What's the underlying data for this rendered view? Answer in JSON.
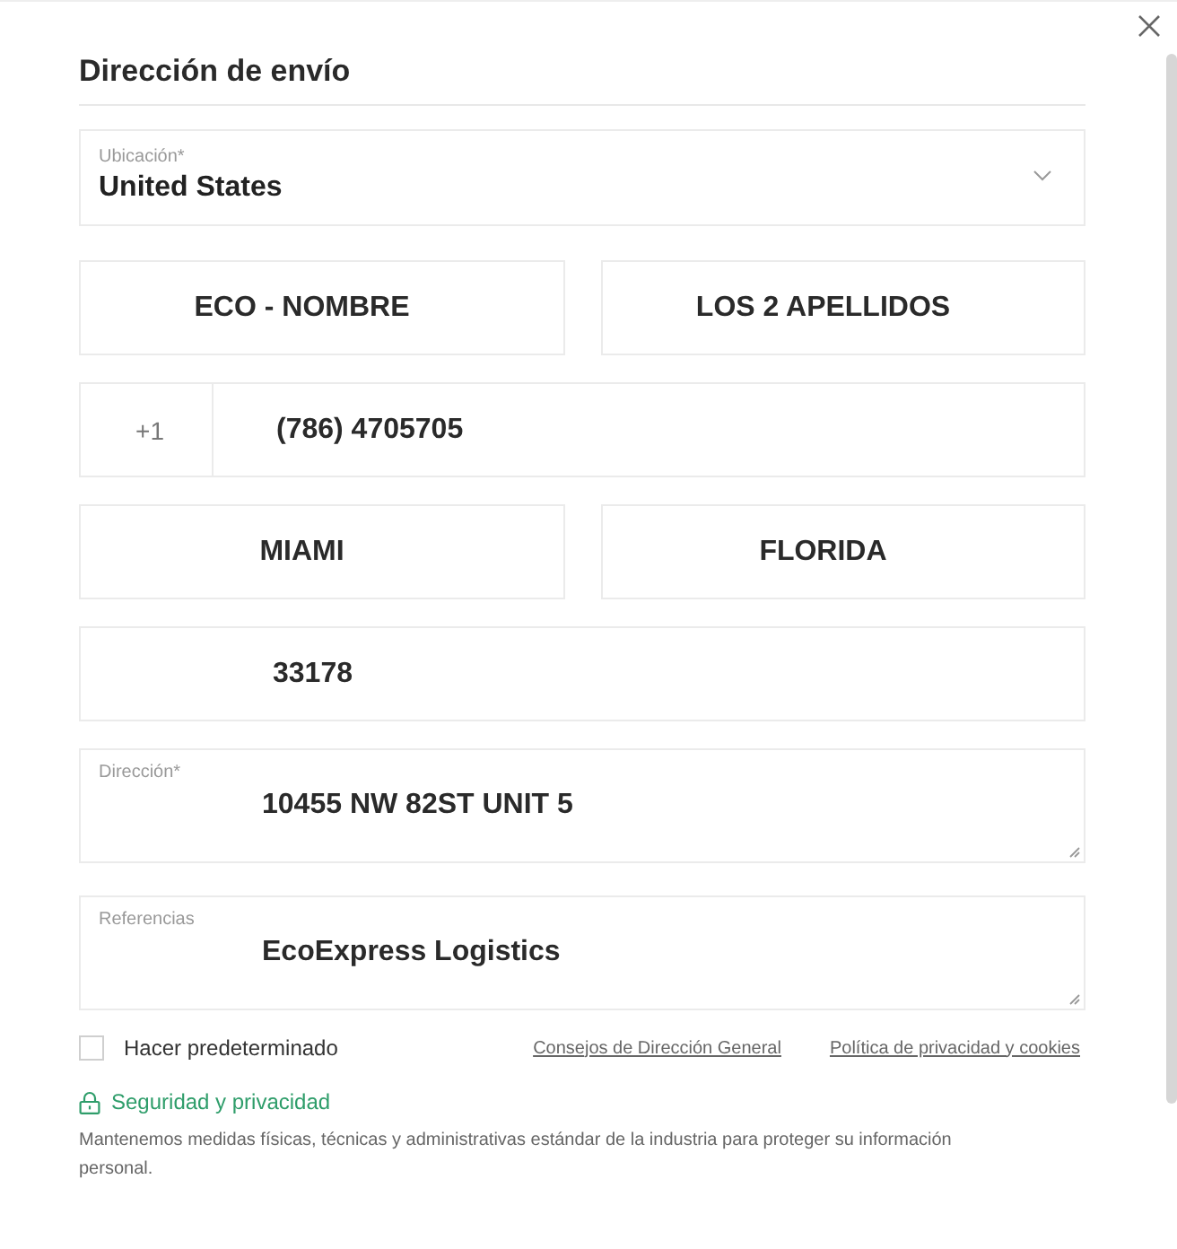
{
  "dialog": {
    "title": "Dirección de envío"
  },
  "location": {
    "label": "Ubicación*",
    "value": "United States"
  },
  "field_rows": [
    [
      {
        "kind": "text",
        "value": "ECO - NOMBRE"
      },
      {
        "kind": "text",
        "value": "LOS 2 APELLIDOS"
      }
    ],
    [
      {
        "kind": "phone",
        "prefix": "+1",
        "value": "(786) 4705705"
      }
    ],
    [
      {
        "kind": "text",
        "value": "MIAMI"
      },
      {
        "kind": "text",
        "value": "FLORIDA"
      }
    ],
    [
      {
        "kind": "text",
        "value": "33178"
      }
    ]
  ],
  "text_areas": [
    {
      "label": "Dirección*",
      "value": "10455 NW 82ST UNIT 5"
    },
    {
      "label": "Referencias",
      "value": "EcoExpress Logistics"
    }
  ],
  "default_option": {
    "label": "Hacer predeterminado",
    "checked": false
  },
  "links": [
    "Consejos de Dirección General",
    "Política de privacidad y cookies"
  ],
  "security": {
    "title": "Seguridad y privacidad",
    "text": "Mantenemos medidas físicas, técnicas y administrativas estándar de la industria para proteger su información personal."
  }
}
